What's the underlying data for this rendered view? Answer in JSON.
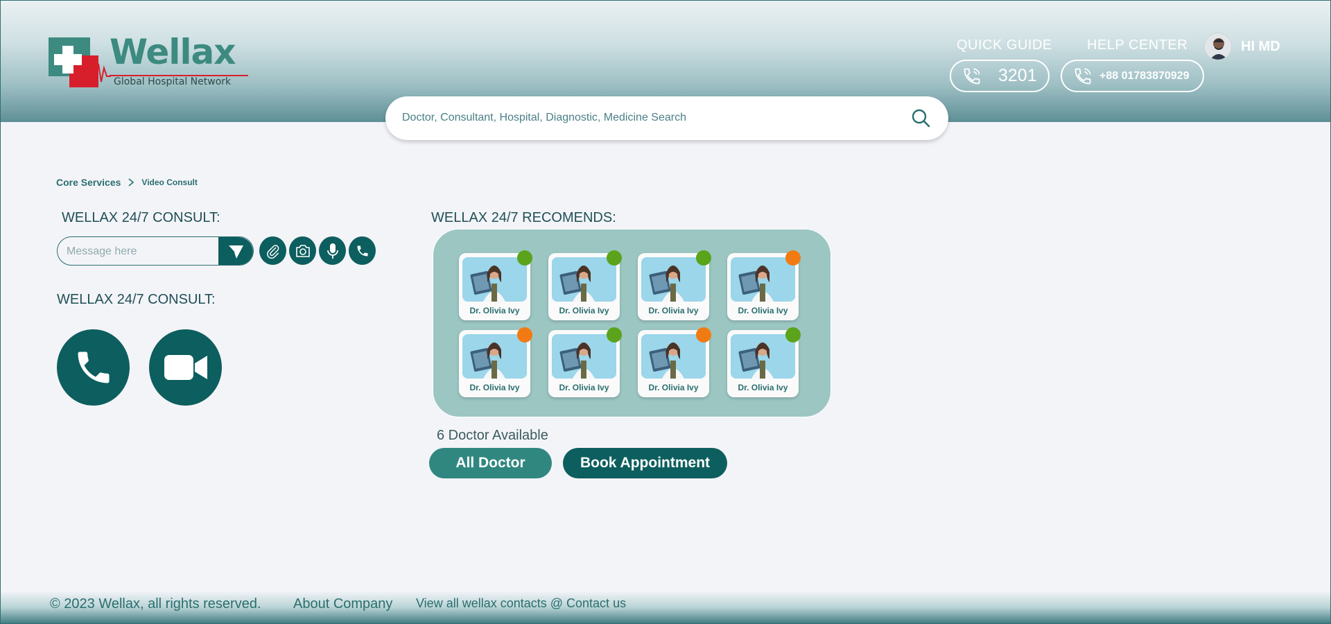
{
  "brand": {
    "name": "Wellax",
    "tagline": "Global Hospital Network"
  },
  "header": {
    "quick_guide_label": "QUICK GUIDE",
    "help_center_label": "HELP CENTER",
    "quick_guide_number": "3201",
    "help_center_number": "+88 01783870929",
    "greeting": "HI MD"
  },
  "search": {
    "placeholder": "Doctor, Consultant, Hospital, Diagnostic, Medicine Search"
  },
  "breadcrumb": {
    "items": [
      "Core Services",
      "Video Consult"
    ]
  },
  "consult": {
    "title_1": "WELLAX 24/7 CONSULT:",
    "message_placeholder": "Message here",
    "title_2": "WELLAX 24/7 CONSULT:"
  },
  "recommends": {
    "title": "WELLAX 24/7 RECOMENDS:",
    "doctors": [
      {
        "name": "Dr. Olivia Ivy",
        "status": "online"
      },
      {
        "name": "Dr. Olivia Ivy",
        "status": "online"
      },
      {
        "name": "Dr. Olivia Ivy",
        "status": "online"
      },
      {
        "name": "Dr. Olivia Ivy",
        "status": "busy"
      },
      {
        "name": "Dr. Olivia Ivy",
        "status": "busy"
      },
      {
        "name": "Dr. Olivia Ivy",
        "status": "online"
      },
      {
        "name": "Dr. Olivia Ivy",
        "status": "busy"
      },
      {
        "name": "Dr. Olivia Ivy",
        "status": "online"
      }
    ],
    "available_text": "6 Doctor Available",
    "all_doctor_label": "All Doctor",
    "book_label": "Book Appointment"
  },
  "footer": {
    "copyright": "© 2023 Wellax, all rights reserved.",
    "about": "About Company",
    "contacts": "View all wellax contacts @ Contact us"
  },
  "colors": {
    "primary": "#0d5e5e",
    "accent": "#2f8780",
    "online": "#5aa31a",
    "busy": "#f27a12",
    "panel": "#9cc6c2"
  },
  "icons": {
    "search": "search-icon",
    "phone": "phone-icon",
    "attach": "paperclip-icon",
    "camera": "camera-icon",
    "mic": "microphone-icon",
    "send": "send-icon",
    "video": "video-camera-icon"
  }
}
